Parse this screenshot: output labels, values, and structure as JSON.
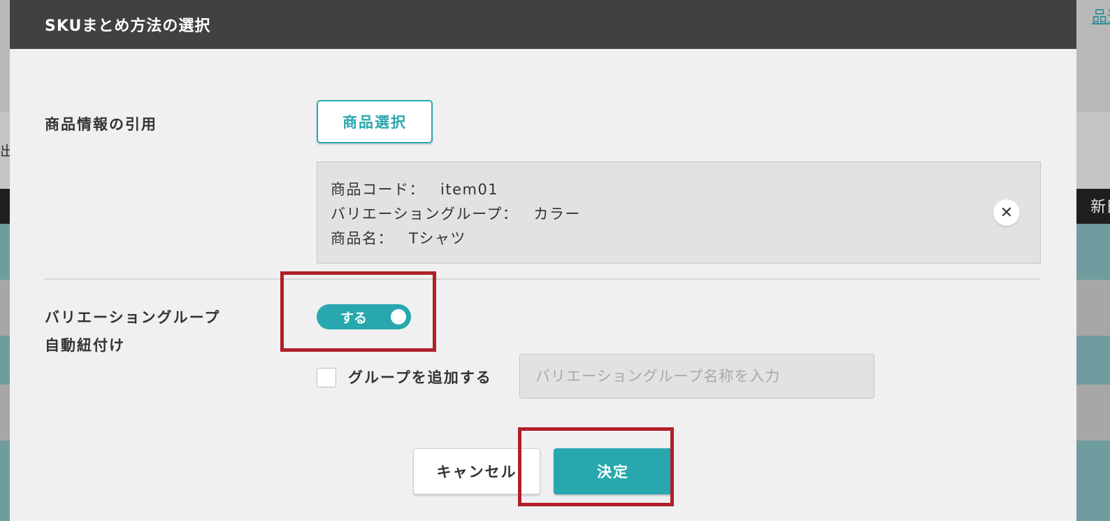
{
  "background": {
    "peek_top_right": "品登",
    "peek_dark_right": "新日",
    "peek_left": "出"
  },
  "dialog": {
    "title": "SKUまとめ方法の選択",
    "product_quote": {
      "label": "商品情報の引用",
      "select_button": "商品選択",
      "info": {
        "code_label": "商品コード：",
        "code_value": "item01",
        "group_label": "バリエーショングループ：",
        "group_value": "カラー",
        "name_label": "商品名：",
        "name_value": "Tシャツ"
      },
      "clear_icon": "close-icon",
      "clear_glyph": "✕"
    },
    "auto_link": {
      "label_line1": "バリエーショングループ",
      "label_line2": "自動紐付け",
      "toggle_label": "する",
      "toggle_on": true,
      "add_group_checked": false,
      "add_group_label": "グループを追加する",
      "group_name_placeholder": "バリエーショングループ名称を入力"
    },
    "buttons": {
      "cancel": "キャンセル",
      "confirm": "決定"
    }
  },
  "colors": {
    "accent": "#28a7ae",
    "header": "#414141",
    "highlight": "#b11f2a",
    "dialog_bg": "#f0f0f0"
  }
}
